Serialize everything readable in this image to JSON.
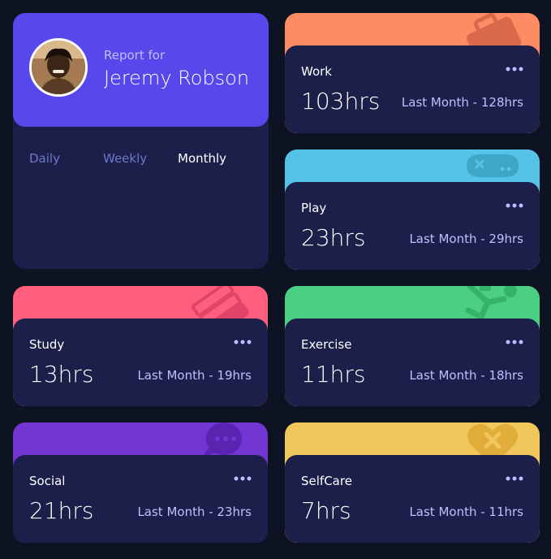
{
  "profile": {
    "report_for": "Report for",
    "name": "Jeremy Robson",
    "tabs": [
      {
        "label": "Daily",
        "active": false
      },
      {
        "label": "Weekly",
        "active": false
      },
      {
        "label": "Monthly",
        "active": true
      }
    ]
  },
  "cards": [
    {
      "title": "Work",
      "current": "103hrs",
      "previous": "Last Month - 128hrs",
      "color": "#ff8b64",
      "icon": "briefcase-icon"
    },
    {
      "title": "Play",
      "current": "23hrs",
      "previous": "Last Month - 29hrs",
      "color": "#55c2e6",
      "icon": "gamepad-icon"
    },
    {
      "title": "Study",
      "current": "13hrs",
      "previous": "Last Month - 19hrs",
      "color": "#ff5e7d",
      "icon": "books-icon"
    },
    {
      "title": "Exercise",
      "current": "11hrs",
      "previous": "Last Month - 18hrs",
      "color": "#4bcf82",
      "icon": "runner-icon"
    },
    {
      "title": "Social",
      "current": "21hrs",
      "previous": "Last Month - 23hrs",
      "color": "#7335d2",
      "icon": "chat-icon"
    },
    {
      "title": "SelfCare",
      "current": "7hrs",
      "previous": "Last Month - 11hrs",
      "color": "#f1c75b",
      "icon": "heart-icon"
    }
  ],
  "colors": {
    "background": "#0e1323",
    "card": "#1c1f4a",
    "accent": "#5847eb",
    "muted_text": "#bbc0ff",
    "tab_text": "#7078c9"
  }
}
